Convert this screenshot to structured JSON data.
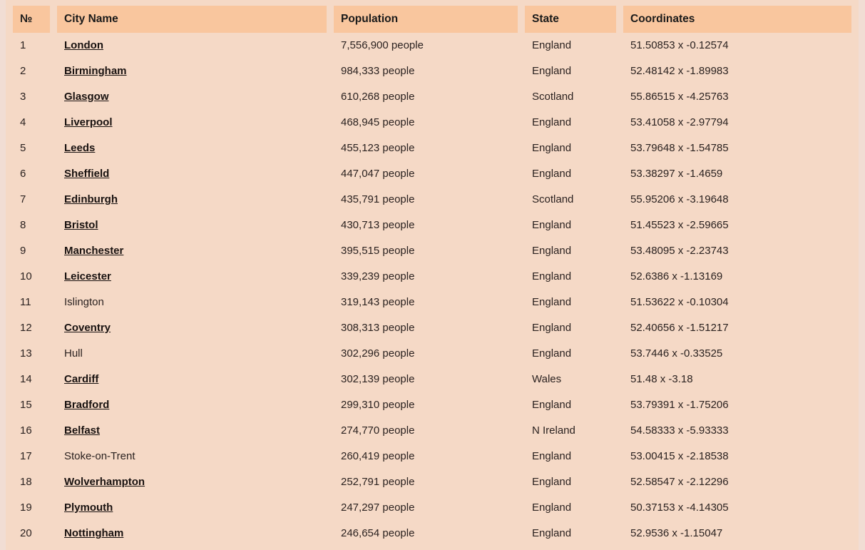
{
  "colors": {
    "page_background": "#f1ddd4",
    "table_background": "#f5d9c6",
    "header_background": "#f9c69e",
    "header_text": "#1a1a1a",
    "body_text": "#2b2220",
    "link_text": "#191210"
  },
  "table": {
    "columns": [
      {
        "key": "num",
        "label": "№"
      },
      {
        "key": "city",
        "label": "City Name"
      },
      {
        "key": "pop",
        "label": "Population"
      },
      {
        "key": "state",
        "label": "State"
      },
      {
        "key": "coord",
        "label": "Coordinates"
      }
    ],
    "rows": [
      {
        "num": "1",
        "city": "London",
        "is_link": true,
        "pop": "7,556,900 people",
        "state": "England",
        "coord": "51.50853 x -0.12574"
      },
      {
        "num": "2",
        "city": "Birmingham",
        "is_link": true,
        "pop": "984,333 people",
        "state": "England",
        "coord": "52.48142 x -1.89983"
      },
      {
        "num": "3",
        "city": "Glasgow",
        "is_link": true,
        "pop": "610,268 people",
        "state": "Scotland",
        "coord": "55.86515 x -4.25763"
      },
      {
        "num": "4",
        "city": "Liverpool",
        "is_link": true,
        "pop": "468,945 people",
        "state": "England",
        "coord": "53.41058 x -2.97794"
      },
      {
        "num": "5",
        "city": "Leeds",
        "is_link": true,
        "pop": "455,123 people",
        "state": "England",
        "coord": "53.79648 x -1.54785"
      },
      {
        "num": "6",
        "city": "Sheffield",
        "is_link": true,
        "pop": "447,047 people",
        "state": "England",
        "coord": "53.38297 x -1.4659"
      },
      {
        "num": "7",
        "city": "Edinburgh",
        "is_link": true,
        "pop": "435,791 people",
        "state": "Scotland",
        "coord": "55.95206 x -3.19648"
      },
      {
        "num": "8",
        "city": "Bristol",
        "is_link": true,
        "pop": "430,713 people",
        "state": "England",
        "coord": "51.45523 x -2.59665"
      },
      {
        "num": "9",
        "city": "Manchester",
        "is_link": true,
        "pop": "395,515 people",
        "state": "England",
        "coord": "53.48095 x -2.23743"
      },
      {
        "num": "10",
        "city": "Leicester",
        "is_link": true,
        "pop": "339,239 people",
        "state": "England",
        "coord": "52.6386 x -1.13169"
      },
      {
        "num": "11",
        "city": "Islington",
        "is_link": false,
        "pop": "319,143 people",
        "state": "England",
        "coord": "51.53622 x -0.10304"
      },
      {
        "num": "12",
        "city": "Coventry",
        "is_link": true,
        "pop": "308,313 people",
        "state": "England",
        "coord": "52.40656 x -1.51217"
      },
      {
        "num": "13",
        "city": "Hull",
        "is_link": false,
        "pop": "302,296 people",
        "state": "England",
        "coord": "53.7446 x -0.33525"
      },
      {
        "num": "14",
        "city": "Cardiff",
        "is_link": true,
        "pop": "302,139 people",
        "state": "Wales",
        "coord": "51.48 x -3.18"
      },
      {
        "num": "15",
        "city": "Bradford",
        "is_link": true,
        "pop": "299,310 people",
        "state": "England",
        "coord": "53.79391 x -1.75206"
      },
      {
        "num": "16",
        "city": "Belfast",
        "is_link": true,
        "pop": "274,770 people",
        "state": "N Ireland",
        "coord": "54.58333 x -5.93333"
      },
      {
        "num": "17",
        "city": "Stoke-on-Trent",
        "is_link": false,
        "pop": "260,419 people",
        "state": "England",
        "coord": "53.00415 x -2.18538"
      },
      {
        "num": "18",
        "city": "Wolverhampton",
        "is_link": true,
        "pop": "252,791 people",
        "state": "England",
        "coord": "52.58547 x -2.12296"
      },
      {
        "num": "19",
        "city": "Plymouth",
        "is_link": true,
        "pop": "247,297 people",
        "state": "England",
        "coord": "50.37153 x -4.14305"
      },
      {
        "num": "20",
        "city": "Nottingham",
        "is_link": true,
        "pop": "246,654 people",
        "state": "England",
        "coord": "52.9536 x -1.15047"
      }
    ]
  }
}
